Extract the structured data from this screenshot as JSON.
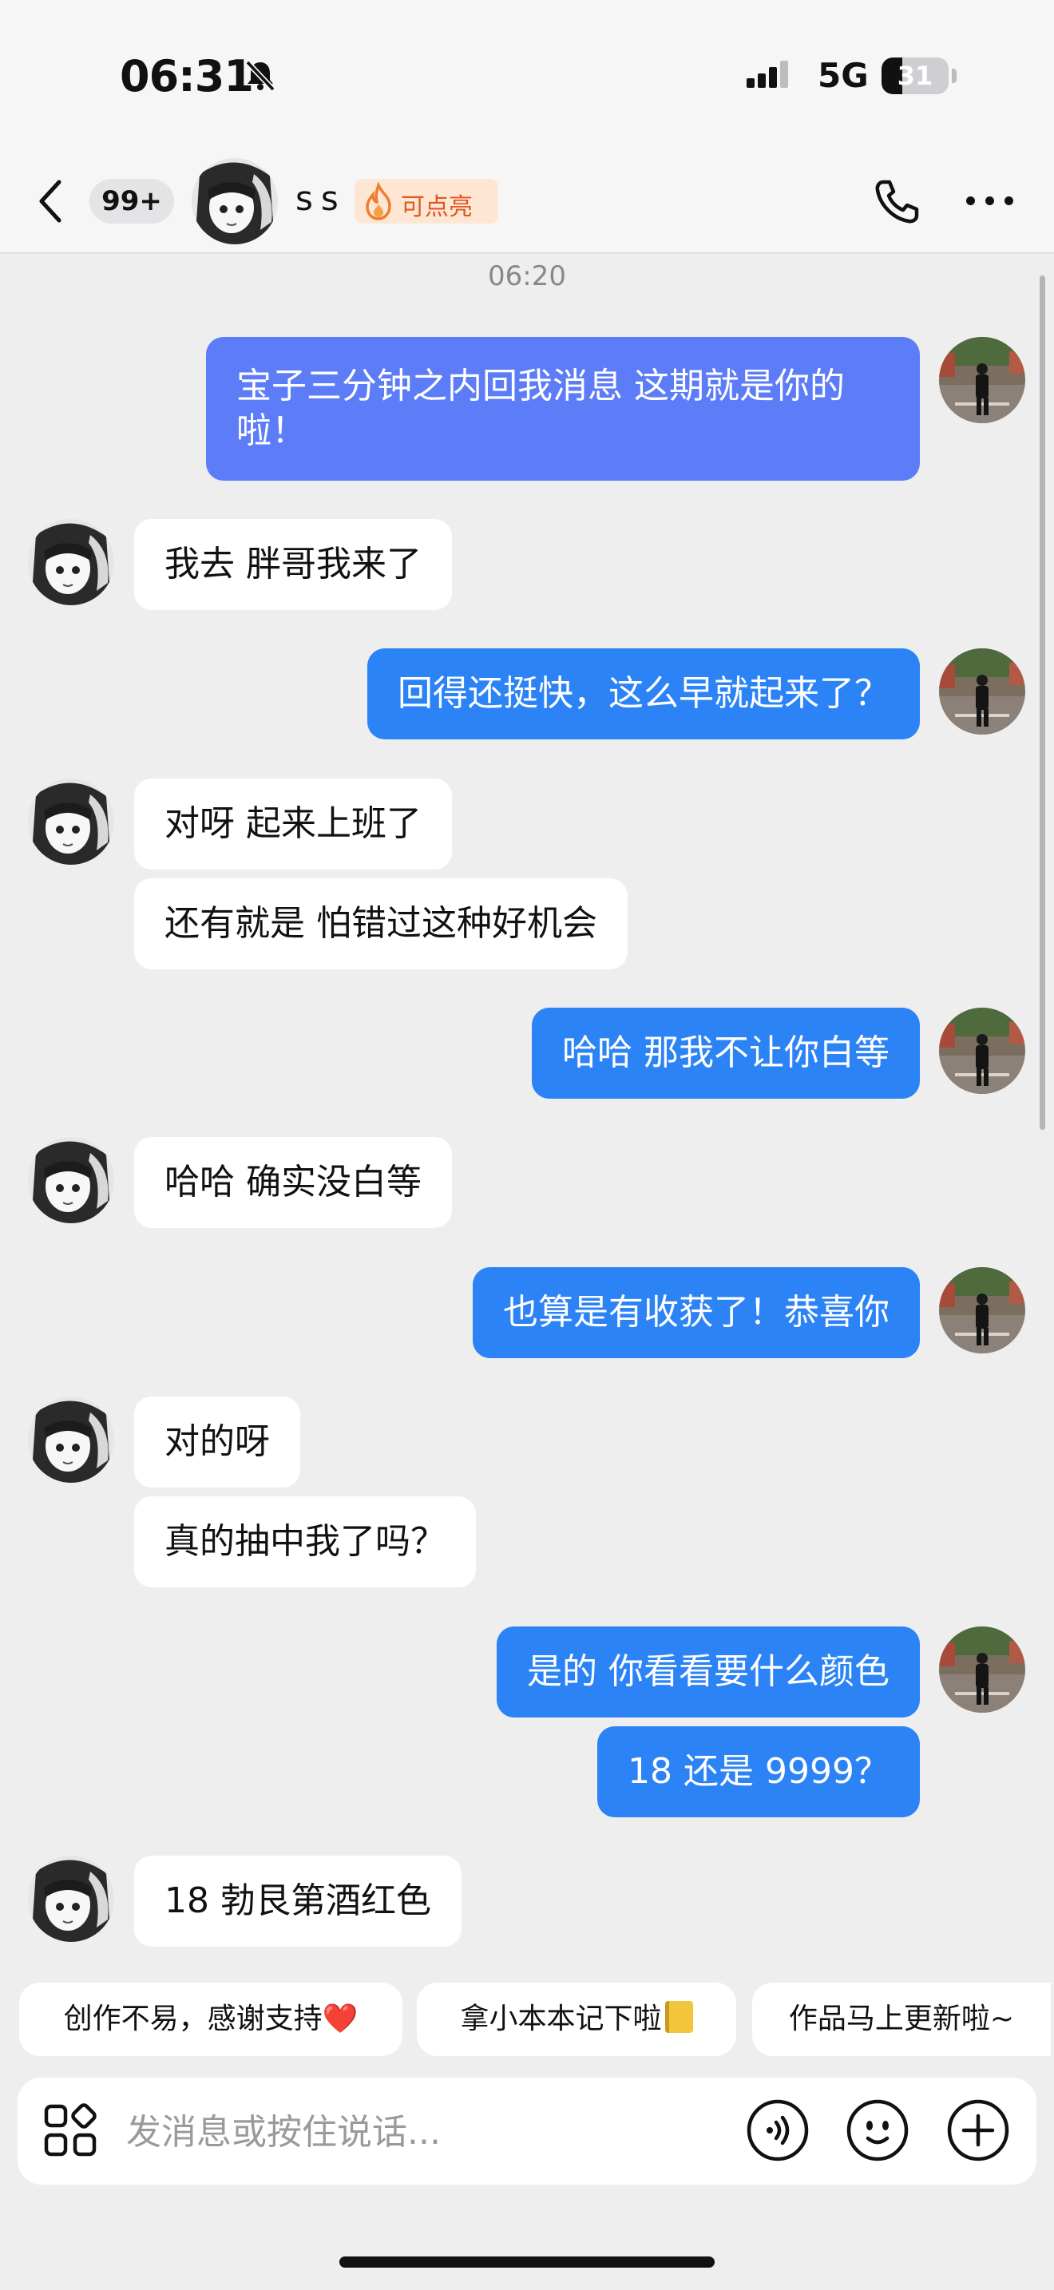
{
  "status_bar": {
    "time": "06:31",
    "network": "5G",
    "battery": "31",
    "battery_level": 0.31
  },
  "header": {
    "unread_count": "99+",
    "contact_name": "ss",
    "fire_label": "可点亮"
  },
  "chat": {
    "timestamp": "06:20",
    "messages": [
      {
        "side": "out",
        "text": "宝子三分钟之内回我消息 这期就是你的啦！"
      },
      {
        "side": "in",
        "text": "我去 胖哥我来了"
      },
      {
        "side": "out",
        "text": "回得还挺快，这么早就起来了？"
      },
      {
        "side": "in",
        "text": "对呀 起来上班了"
      },
      {
        "side": "in",
        "text": "还有就是 怕错过这种好机会"
      },
      {
        "side": "out",
        "text": "哈哈  那我不让你白等"
      },
      {
        "side": "in",
        "text": "哈哈 确实没白等"
      },
      {
        "side": "out",
        "text": "也算是有收获了！恭喜你"
      },
      {
        "side": "in",
        "text": "对的呀"
      },
      {
        "side": "in",
        "text": "真的抽中我了吗？"
      },
      {
        "side": "out",
        "text": "是的 你看看要什么颜色"
      },
      {
        "side": "out",
        "text": "18 还是 9999？"
      },
      {
        "side": "in",
        "text": "18 勃艮第酒红色"
      }
    ]
  },
  "quick_replies": [
    "创作不易，感谢支持",
    "拿小本本记下啦",
    "作品马上更新啦~"
  ],
  "quick_reply_emoji": [
    "❤️",
    ""
  ],
  "input": {
    "placeholder": "发消息或按住说话..."
  },
  "icons": {
    "back": "chevron-left-icon",
    "phone": "phone-icon",
    "more": "more-icon",
    "apps": "apps-grid-icon",
    "voice": "voice-icon",
    "emoji": "emoji-icon",
    "add": "plus-circle-icon"
  },
  "colors": {
    "outgoing_bubble": "#2b83f6",
    "outgoing_bubble_first": "#5d7cf8",
    "incoming_bubble": "#ffffff",
    "background": "#eeeeef",
    "fire_text": "#e2561f"
  }
}
